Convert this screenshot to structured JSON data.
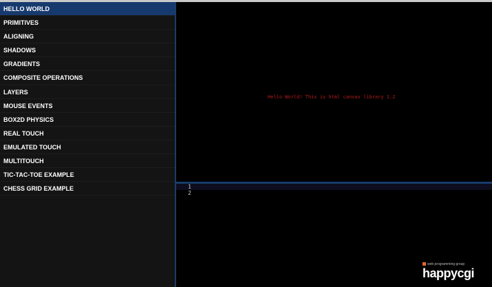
{
  "sidebar": {
    "items": [
      {
        "label": "HELLO WORLD",
        "active": true
      },
      {
        "label": "PRIMITIVES"
      },
      {
        "label": "ALIGNING"
      },
      {
        "label": "SHADOWS"
      },
      {
        "label": "GRADIENTS"
      },
      {
        "label": "COMPOSITE OPERATIONS"
      },
      {
        "label": "LAYERS"
      },
      {
        "label": "MOUSE EVENTS"
      },
      {
        "label": "BOX2D PHYSICS"
      },
      {
        "label": "REAL TOUCH"
      },
      {
        "label": "EMULATED TOUCH"
      },
      {
        "label": "MULTITOUCH"
      },
      {
        "label": "TIC-TAC-TOE EXAMPLE"
      },
      {
        "label": "CHESS GRID EXAMPLE"
      }
    ]
  },
  "canvas": {
    "text": "Hello World! This is html canvas library 1.2"
  },
  "editor": {
    "lines": [
      "1",
      "2"
    ]
  },
  "brand": {
    "tagline": "web programming group",
    "logo": "happycgi"
  },
  "colors": {
    "active_item": "#173a6e",
    "divider": "#183d6b",
    "canvas_text": "#b51a1a",
    "brand_mark": "#e2692a"
  }
}
